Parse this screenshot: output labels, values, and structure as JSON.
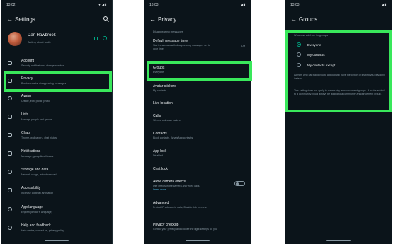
{
  "screen1": {
    "time": "13:02",
    "status_icons": "▼◢▮",
    "title": "Settings",
    "profile": {
      "name": "Dan Hawbrook",
      "about": "Battery about to die"
    },
    "items": [
      {
        "label": "Account",
        "sub": "Security notifications, change number"
      },
      {
        "label": "Privacy",
        "sub": "Block contacts, disappearing messages"
      },
      {
        "label": "Avatar",
        "sub": "Create, edit, profile photo"
      },
      {
        "label": "Lists",
        "sub": "Manage people and groups"
      },
      {
        "label": "Chats",
        "sub": "Theme, wallpapers, chat history"
      },
      {
        "label": "Notifications",
        "sub": "Message, group & call tones"
      },
      {
        "label": "Storage and data",
        "sub": "Network usage, auto-download"
      },
      {
        "label": "Accessibility",
        "sub": "Increase contrast, animation"
      },
      {
        "label": "App language",
        "sub": "English (device's language)"
      },
      {
        "label": "Help and feedback",
        "sub": "Help centre, contact us, privacy policy"
      }
    ]
  },
  "screen2": {
    "time": "13:03",
    "status_icons": "◢▮",
    "title": "Privacy",
    "section": "Disappearing messages",
    "timer": {
      "label": "Default message timer",
      "sub1": "Start new chats with disappearing messages set to",
      "sub2": "your timer",
      "value": "Off"
    },
    "items": [
      {
        "label": "Groups",
        "sub": "Everyone"
      },
      {
        "label": "Avatar stickers",
        "sub": "My contacts"
      },
      {
        "label": "Live location",
        "sub": ""
      },
      {
        "label": "Calls",
        "sub": "Silence unknown callers"
      },
      {
        "label": "Contacts",
        "sub": "Block contacts, WhatsApp contacts"
      },
      {
        "label": "App lock",
        "sub": "Disabled"
      },
      {
        "label": "Chat lock",
        "sub": ""
      },
      {
        "label": "Allow camera effects",
        "sub": "Use effects in the camera and video calls.",
        "link": "Learn more"
      },
      {
        "label": "Advanced",
        "sub": "Protect IP address in calls, Disable link previews"
      },
      {
        "label": "Privacy checkup",
        "sub": "Control your privacy and choose the right settings for you"
      }
    ]
  },
  "screen3": {
    "time": "13:03",
    "status_icons": "◢▮",
    "title": "Groups",
    "question": "Who can add me to groups",
    "options": [
      "Everyone",
      "My contacts",
      "My contacts except..."
    ],
    "selected_index": 0,
    "note1": "Admins who can't add you to a group will have the option of inviting you privately instead.",
    "note2": "This setting does not apply to community announcement groups. If you're added to a community, you'll always be added to a community announcement group."
  },
  "colors": {
    "accent": "#00a884",
    "highlight": "#39e85b",
    "background": "#0b141a"
  }
}
